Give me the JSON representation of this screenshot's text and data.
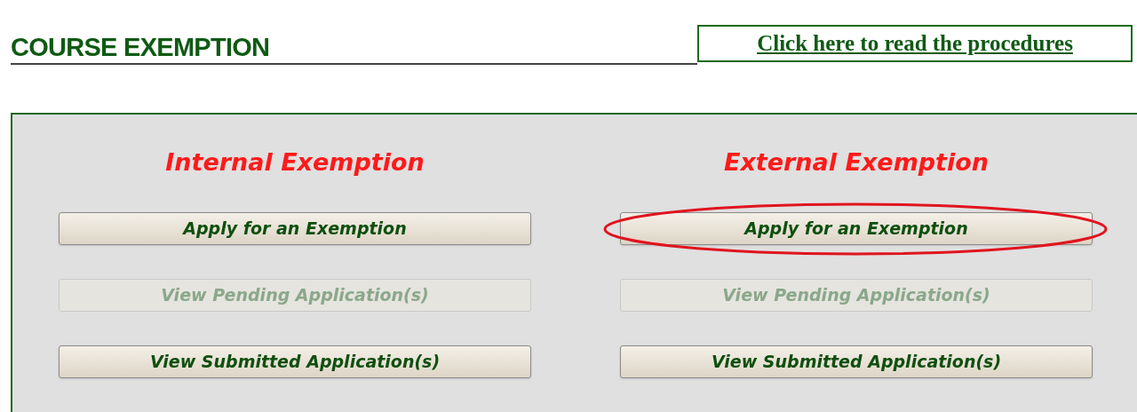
{
  "title": "COURSE EXEMPTION",
  "procedures_link": "Click here to read the procedures",
  "columns": [
    {
      "heading": "Internal Exemption",
      "buttons": [
        {
          "label": "Apply for an Exemption",
          "disabled": false,
          "circled": false
        },
        {
          "label": "View Pending Application(s)",
          "disabled": true,
          "circled": false
        },
        {
          "label": "View Submitted Application(s)",
          "disabled": false,
          "circled": false
        }
      ]
    },
    {
      "heading": "External Exemption",
      "buttons": [
        {
          "label": "Apply for an Exemption",
          "disabled": false,
          "circled": true
        },
        {
          "label": "View Pending Application(s)",
          "disabled": true,
          "circled": false
        },
        {
          "label": "View Submitted Application(s)",
          "disabled": false,
          "circled": false
        }
      ]
    }
  ]
}
